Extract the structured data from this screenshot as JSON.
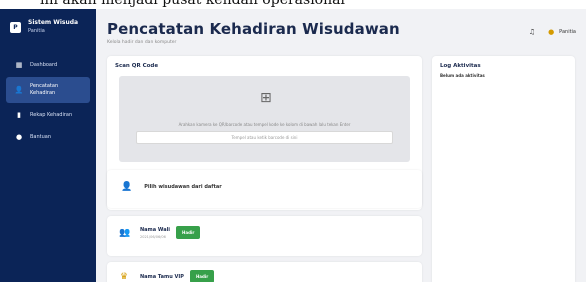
{
  "top_band": {
    "text": "ini akan menjadi pusat kendali operasional"
  },
  "sidebar": {
    "logo_letter": "P",
    "app_title": "Sistem Wisuda",
    "app_sub": "Panitia",
    "items": [
      {
        "label": "Dashboard",
        "icon": "grid-icon"
      },
      {
        "label": "Pencatatan Kehadiran",
        "icon": "user-plus-icon",
        "active": true
      },
      {
        "label": "Rekap Kehadiran",
        "icon": "clipboard-icon"
      },
      {
        "label": "Bantuan",
        "icon": "help-icon"
      }
    ]
  },
  "header": {
    "title": "Pencatatan Kehadiran Wisudawan",
    "subtitle": "Kelola hadir dan dan komputer"
  },
  "topbar": {
    "user_name": "Panitia"
  },
  "scan": {
    "title": "Scan QR Code",
    "hint": "Arahkan kamera ke QR/barcode atau tempel kode ke kolom di bawah lalu tekan Enter",
    "input_placeholder": "Tempel atau ketik barcode di sini"
  },
  "pick": {
    "label": "Pilih wisudawan dari daftar"
  },
  "rows": [
    {
      "name": "Nama Wali",
      "sub": "2021/06/06/06",
      "button": "Hadir"
    },
    {
      "name": "Nama Tamu VIP",
      "button": "Hadir"
    }
  ],
  "log": {
    "title": "Log Aktivitas",
    "empty": "Belum ada aktivitas"
  },
  "colors": {
    "sidebar": "#0b2457",
    "accent_green": "#37a04a",
    "title": "#1b2a4e"
  }
}
